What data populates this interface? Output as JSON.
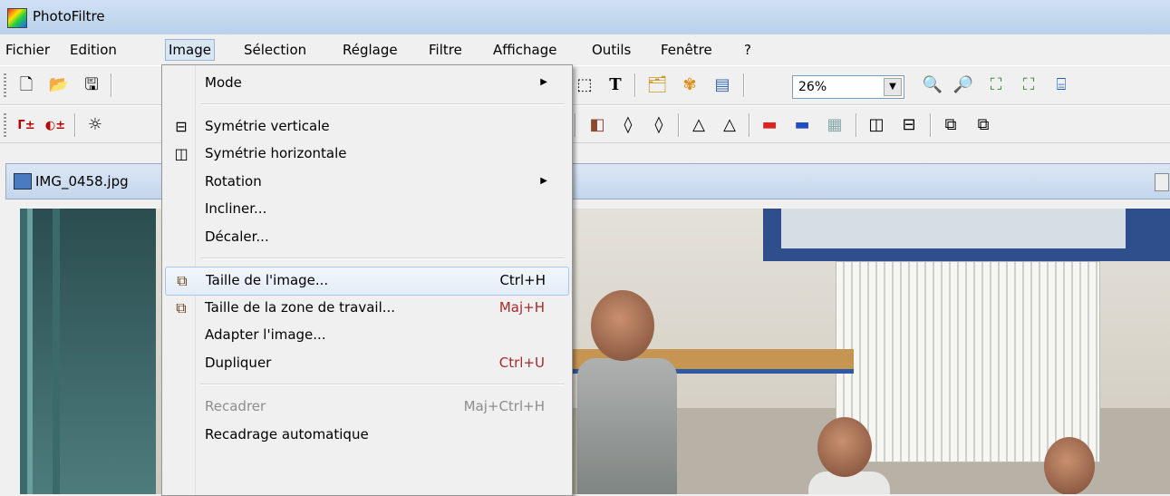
{
  "app": {
    "title": "PhotoFiltre"
  },
  "menubar": {
    "items": [
      "Fichier",
      "Edition",
      "Image",
      "Sélection",
      "Réglage",
      "Filtre",
      "Affichage",
      "Outils",
      "Fenêtre",
      "?"
    ]
  },
  "toolbar": {
    "zoom_value": "26%"
  },
  "document": {
    "title": "IMG_0458.jpg"
  },
  "image_menu": {
    "items": [
      {
        "label": "Mode",
        "submenu": true
      },
      {
        "label": "Symétrie verticale",
        "icon": "flip-vertical-icon"
      },
      {
        "label": "Symétrie horizontale",
        "icon": "flip-horizontal-icon"
      },
      {
        "label": "Rotation",
        "submenu": true
      },
      {
        "label": "Incliner..."
      },
      {
        "label": "Décaler..."
      },
      {
        "label": "Taille de l'image...",
        "shortcut": "Ctrl+H",
        "icon": "image-size-icon",
        "highlighted": true
      },
      {
        "label": "Taille de la zone de travail...",
        "shortcut": "Maj+H",
        "icon": "canvas-size-icon"
      },
      {
        "label": "Adapter l'image..."
      },
      {
        "label": "Dupliquer",
        "shortcut": "Ctrl+U"
      },
      {
        "label": "Recadrer",
        "shortcut": "Maj+Ctrl+H",
        "disabled": true
      },
      {
        "label": "Recadrage automatique"
      }
    ]
  }
}
